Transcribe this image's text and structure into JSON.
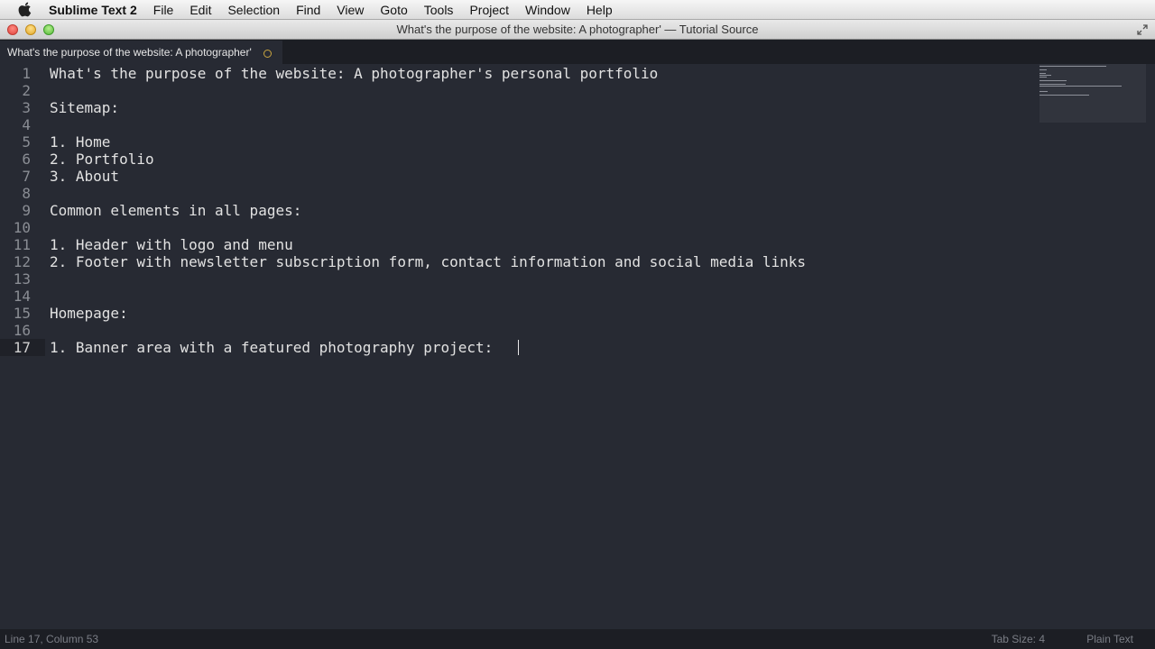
{
  "menubar": {
    "app_name": "Sublime Text 2",
    "items": [
      "File",
      "Edit",
      "Selection",
      "Find",
      "View",
      "Goto",
      "Tools",
      "Project",
      "Window",
      "Help"
    ]
  },
  "window": {
    "title": "What's the purpose of the website: A photographer' — Tutorial Source"
  },
  "tab": {
    "title": "What's the purpose of the website: A photographer'"
  },
  "editor": {
    "current_line": 17,
    "lines": [
      "What's the purpose of the website: A photographer's personal portfolio",
      "",
      "Sitemap:",
      "",
      "1. Home",
      "2. Portfolio",
      "3. About",
      "",
      "Common elements in all pages:",
      "",
      "1. Header with logo and menu",
      "2. Footer with newsletter subscription form, contact information and social media links",
      "",
      "",
      "Homepage:",
      "",
      "1. Banner area with a featured photography project: "
    ]
  },
  "status": {
    "position": "Line 17, Column 53",
    "tab_size": "Tab Size: 4",
    "syntax": "Plain Text"
  },
  "colors": {
    "editor_bg": "#272a33",
    "dirty_indicator": "#c9a540"
  }
}
